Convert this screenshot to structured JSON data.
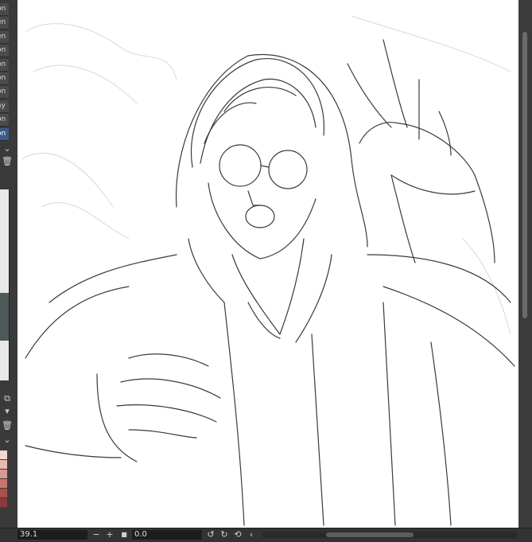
{
  "layers_panel": {
    "tabs": [
      {
        "label": "on"
      },
      {
        "label": "en"
      },
      {
        "label": "en"
      },
      {
        "label": "on"
      },
      {
        "label": "on"
      },
      {
        "label": "on"
      },
      {
        "label": "on"
      },
      {
        "label": "ay"
      },
      {
        "label": "on"
      },
      {
        "label": "on",
        "selected": true
      }
    ]
  },
  "swatches": [
    "#f3d6d0",
    "#e8b9b0",
    "#d89a92",
    "#c8766f",
    "#a9504c",
    "#8a3a3a"
  ],
  "statusbar": {
    "zoom_value": "39.1",
    "rotation_value": "0.0"
  }
}
